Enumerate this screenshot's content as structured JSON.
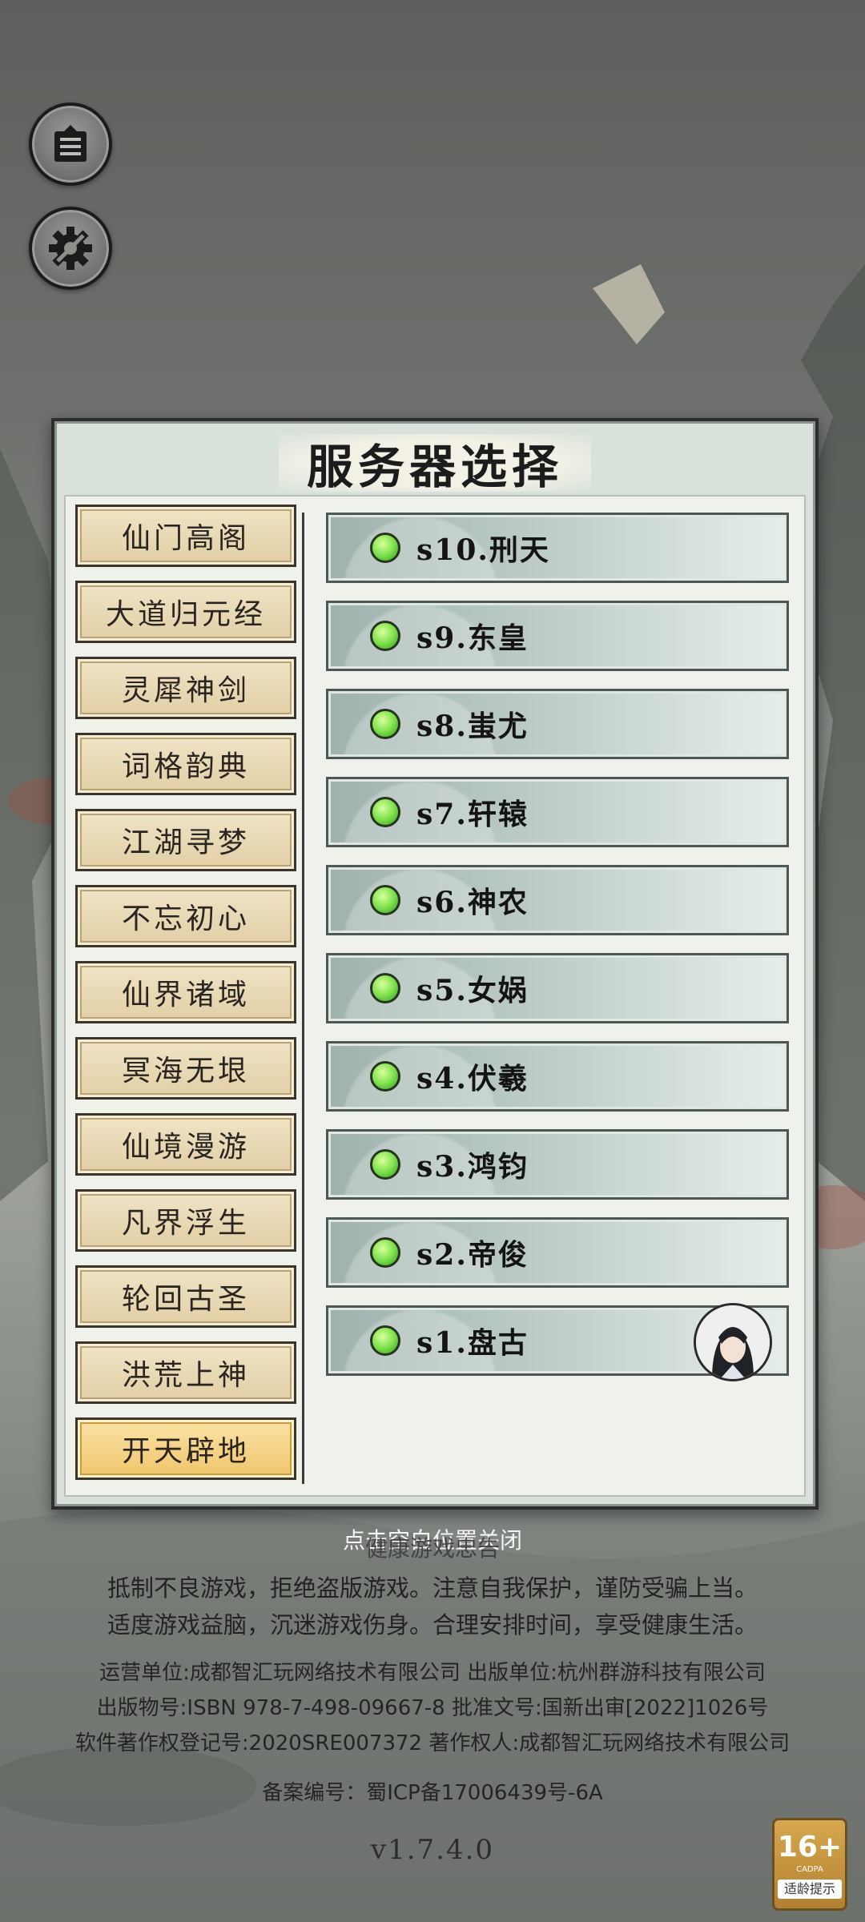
{
  "title": "服务器选择",
  "categories": [
    {
      "label": "仙门高阁",
      "selected": false
    },
    {
      "label": "大道归元经",
      "selected": false
    },
    {
      "label": "灵犀神剑",
      "selected": false
    },
    {
      "label": "词格韵典",
      "selected": false
    },
    {
      "label": "江湖寻梦",
      "selected": false
    },
    {
      "label": "不忘初心",
      "selected": false
    },
    {
      "label": "仙界诸域",
      "selected": false
    },
    {
      "label": "冥海无垠",
      "selected": false
    },
    {
      "label": "仙境漫游",
      "selected": false
    },
    {
      "label": "凡界浮生",
      "selected": false
    },
    {
      "label": "轮回古圣",
      "selected": false
    },
    {
      "label": "洪荒上神",
      "selected": false
    },
    {
      "label": "开天辟地",
      "selected": true
    }
  ],
  "servers": [
    {
      "label": "s10.刑天",
      "status": "online"
    },
    {
      "label": "s9.东皇",
      "status": "online"
    },
    {
      "label": "s8.蚩尤",
      "status": "online"
    },
    {
      "label": "s7.轩辕",
      "status": "online"
    },
    {
      "label": "s6.神农",
      "status": "online"
    },
    {
      "label": "s5.女娲",
      "status": "online"
    },
    {
      "label": "s4.伏羲",
      "status": "online"
    },
    {
      "label": "s3.鸿钧",
      "status": "online"
    },
    {
      "label": "s2.帝俊",
      "status": "online"
    },
    {
      "label": "s1.盘古",
      "status": "online",
      "has_avatar": true
    }
  ],
  "close_hint": "点击空白位置关闭",
  "notice_title": "健康游戏忠告",
  "notice_lines": [
    "抵制不良游戏，拒绝盗版游戏。注意自我保护，谨防受骗上当。",
    "适度游戏益脑，沉迷游戏伤身。合理安排时间，享受健康生活。"
  ],
  "legal_lines": [
    "运营单位:成都智汇玩网络技术有限公司  出版单位:杭州群游科技有限公司",
    "出版物号:ISBN 978-7-498-09667-8  批准文号:国新出审[2022]1026号",
    "软件著作权登记号:2020SRE007372  著作权人:成都智汇玩网络技术有限公司"
  ],
  "icp": "备案编号：蜀ICP备17006439号-6A",
  "version": "v1.7.4.0",
  "age_rating": {
    "value": "16+",
    "org": "CADPA",
    "label": "适龄提示"
  },
  "icons": {
    "top": "notice-board-icon",
    "settings": "gear-icon"
  },
  "colors": {
    "online": "#7fe24c",
    "selected_category": "#efc56b"
  }
}
